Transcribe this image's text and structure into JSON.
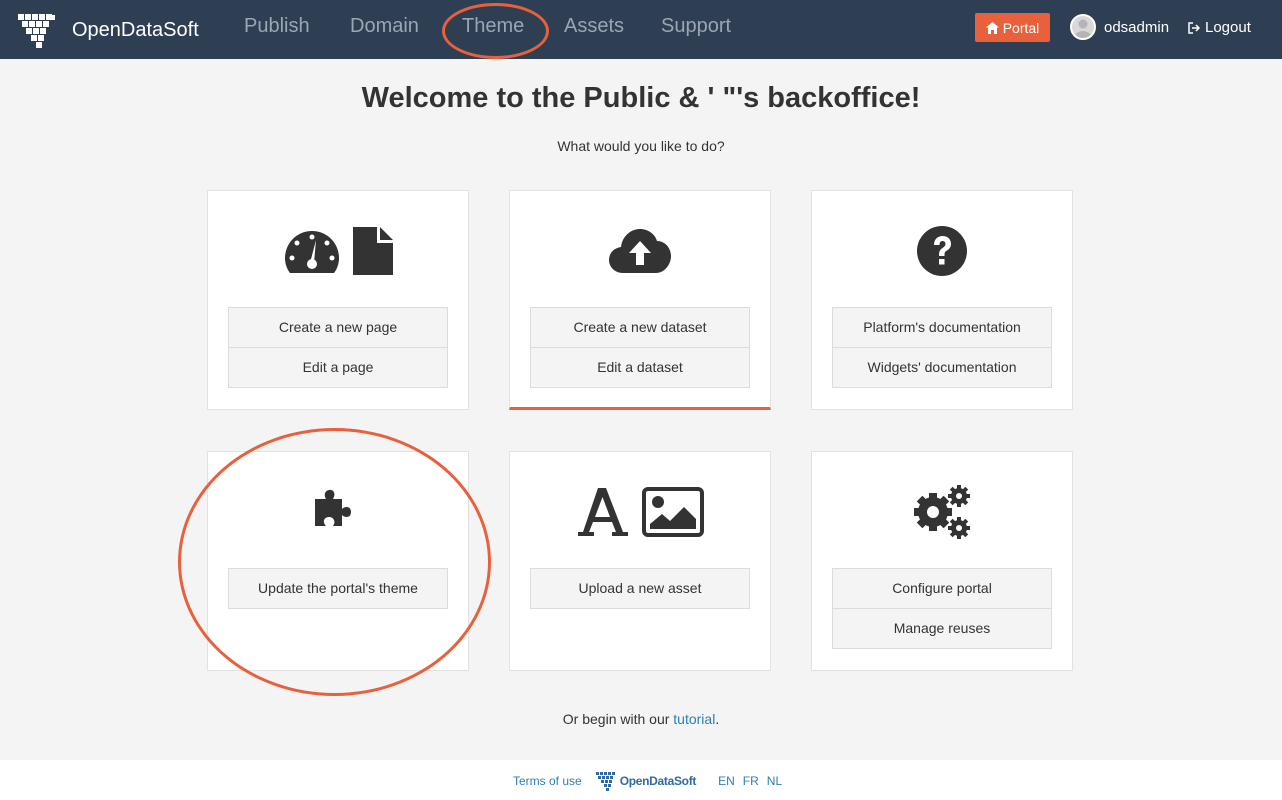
{
  "header": {
    "brand": "OpenDataSoft",
    "nav": [
      "Publish",
      "Domain",
      "Theme",
      "Assets",
      "Support"
    ],
    "portal_label": "Portal",
    "username": "odsadmin",
    "logout_label": "Logout"
  },
  "main": {
    "title": "Welcome to the Public & ' \"'s backoffice!",
    "subtitle": "What would you like to do?",
    "cards": [
      {
        "icons": [
          "dashboard-icon",
          "file-icon"
        ],
        "buttons": [
          "Create a new page",
          "Edit a page"
        ]
      },
      {
        "icons": [
          "cloud-upload-icon"
        ],
        "buttons": [
          "Create a new dataset",
          "Edit a dataset"
        ]
      },
      {
        "icons": [
          "question-circle-icon"
        ],
        "buttons": [
          "Platform's documentation",
          "Widgets' documentation"
        ]
      },
      {
        "icons": [
          "puzzle-icon"
        ],
        "buttons": [
          "Update the portal's theme"
        ]
      },
      {
        "icons": [
          "font-icon",
          "image-icon"
        ],
        "buttons": [
          "Upload a new asset"
        ]
      },
      {
        "icons": [
          "gears-icon"
        ],
        "buttons": [
          "Configure portal",
          "Manage reuses"
        ]
      }
    ],
    "tutorial_prefix": "Or begin with our ",
    "tutorial_link": "tutorial",
    "tutorial_suffix": "."
  },
  "footer": {
    "terms": "Terms of use",
    "logo_text": "OpenDataSoft",
    "languages": [
      "EN",
      "FR",
      "NL"
    ]
  },
  "colors": {
    "header_bg": "#2f3f53",
    "accent": "#e8603c",
    "link": "#2b7fb8"
  }
}
